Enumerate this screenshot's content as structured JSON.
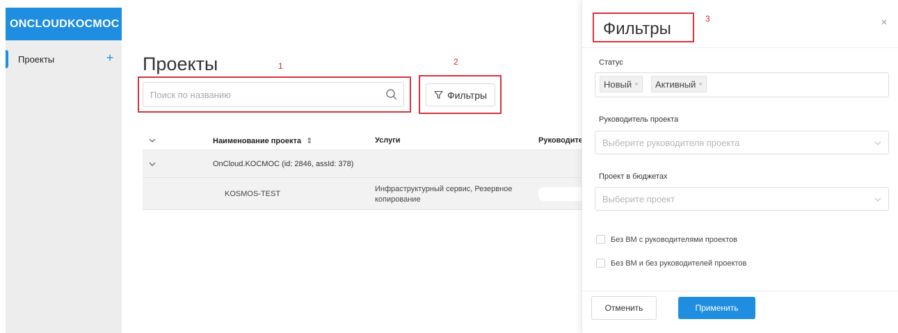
{
  "sidebar": {
    "logo": "ONCLOUDKOCMOC",
    "items": [
      {
        "label": "Проекты",
        "add": "+"
      }
    ]
  },
  "main": {
    "title": "Проекты",
    "search": {
      "placeholder": "Поиск по названию",
      "value": ""
    },
    "filter_button": "Фильтры",
    "table": {
      "columns": [
        "Наименование проекта",
        "Услуги",
        "Руководите"
      ],
      "sort_glyph": "⇕",
      "rows": [
        {
          "name": "OnCloud.KOCMOC (id: 2846, assId: 378)",
          "children": [
            {
              "name": "KOSMOS-TEST",
              "services_line1": "Инфраструктурный сервис, Резервное",
              "services_line2": "копирование"
            }
          ]
        }
      ]
    }
  },
  "annotations": {
    "a1": "1",
    "a2": "2",
    "a3": "3"
  },
  "panel": {
    "title": "Фильтры",
    "close": "×",
    "status": {
      "label": "Статус",
      "tags": [
        "Новый",
        "Активный"
      ],
      "tag_remove": "×"
    },
    "manager": {
      "label": "Руководитель проекта",
      "placeholder": "Выберите руководителя проекта"
    },
    "budget": {
      "label": "Проект в бюджетах",
      "placeholder": "Выберите проект"
    },
    "checks": [
      {
        "label": "Без ВМ с руководителями проектов",
        "checked": false
      },
      {
        "label": "Без ВМ и без руководителей проектов",
        "checked": false
      }
    ],
    "cancel": "Отменить",
    "apply": "Применить"
  },
  "colors": {
    "accent": "#1f8ee0",
    "annotation": "#d9313a",
    "sidebar_bg": "#ededed"
  }
}
